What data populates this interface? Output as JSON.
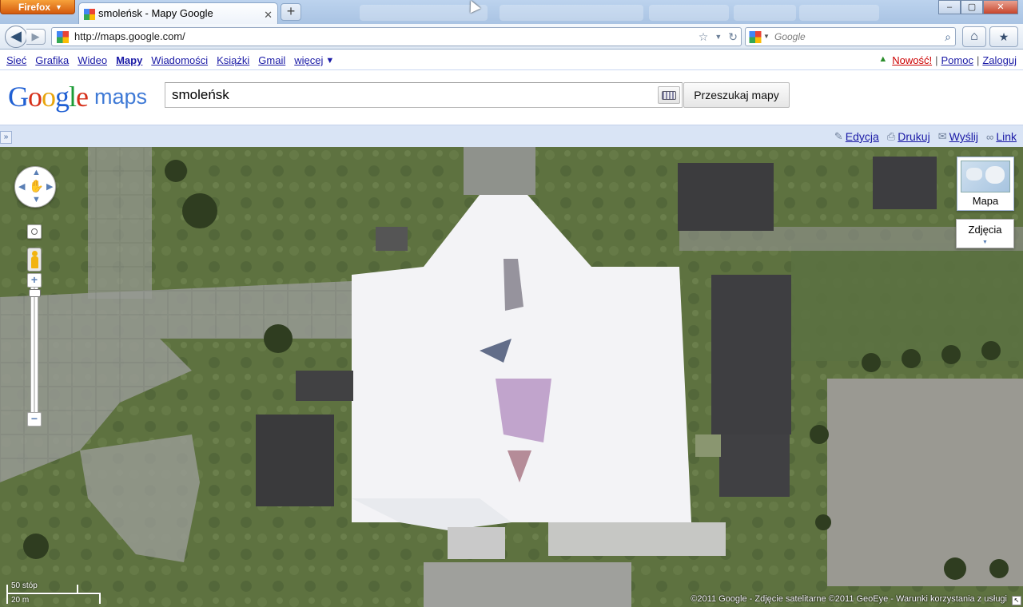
{
  "browser": {
    "app_button": "Firefox",
    "tab_title": "smoleńsk - Mapy Google",
    "new_tab": "+",
    "url": "http://maps.google.com/",
    "search_engine": "Google",
    "window_controls": {
      "minimize": "–",
      "maximize": "▢",
      "close": "✕"
    }
  },
  "gbar": {
    "items": [
      {
        "label": "Sieć",
        "selected": false
      },
      {
        "label": "Grafika",
        "selected": false
      },
      {
        "label": "Wideo",
        "selected": false
      },
      {
        "label": "Mapy",
        "selected": true
      },
      {
        "label": "Wiadomości",
        "selected": false
      },
      {
        "label": "Książki",
        "selected": false
      },
      {
        "label": "Gmail",
        "selected": false
      },
      {
        "label": "więcej",
        "selected": false
      }
    ],
    "more_arrow": "▼",
    "right": {
      "new": "Nowość!",
      "help": "Pomoc",
      "login": "Zaloguj",
      "separator": "|"
    }
  },
  "header": {
    "logo_maps": "maps",
    "query": "smoleńsk",
    "search_button": "Przeszukaj mapy"
  },
  "toolbar": {
    "collapse": "»",
    "edit": "Edycja",
    "print": "Drukuj",
    "send": "Wyślij",
    "link": "Link"
  },
  "map": {
    "map_type": "Mapa",
    "photos": "Zdjęcia",
    "photos_arrow": "▼",
    "scale_imperial": "50 stóp",
    "scale_metric": "20 m",
    "copyright": "©2011 Google - Zdjęcie satelitarne ©2011 GeoEye - Warunki korzystania z usługi",
    "resize_icon": "↖"
  },
  "colors": {
    "gbar_link": "#1a1aa6",
    "toolbar_bg": "#d9e4f5",
    "grass": "#5b6e3f",
    "concrete": "#f3f3f6"
  }
}
